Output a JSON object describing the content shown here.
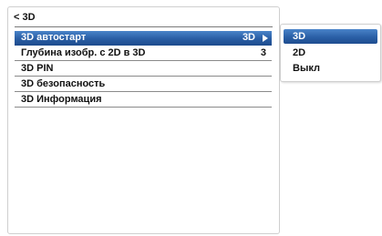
{
  "header": {
    "back_label": "< 3D"
  },
  "menu": {
    "items": [
      {
        "label": "3D автостарт",
        "value": "3D"
      },
      {
        "label": "Глубина изобр. с 2D в 3D",
        "value": "3"
      },
      {
        "label": "3D PIN",
        "value": ""
      },
      {
        "label": "3D безопасность",
        "value": ""
      },
      {
        "label": "3D Информация",
        "value": ""
      }
    ]
  },
  "submenu": {
    "options": [
      {
        "label": "3D"
      },
      {
        "label": "2D"
      },
      {
        "label": "Выкл"
      }
    ]
  },
  "colors": {
    "accent": "#2a5fa6",
    "text": "#111111",
    "background": "#ffffff"
  }
}
